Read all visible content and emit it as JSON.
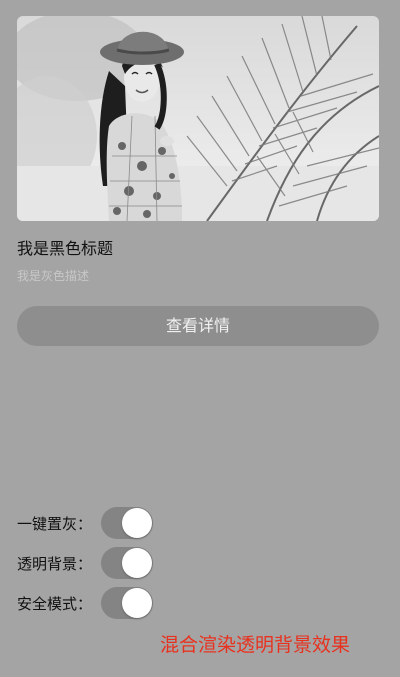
{
  "card": {
    "image_description": "",
    "title": "我是黑色标题",
    "description": "我是灰色描述",
    "detail_button_label": "查看详情"
  },
  "toggles": [
    {
      "label": "一键置灰：",
      "on": true
    },
    {
      "label": "透明背景：",
      "on": true
    },
    {
      "label": "安全模式：",
      "on": true
    }
  ],
  "caption": "混合渲染透明背景效果",
  "colors": {
    "background": "#a4a4a4",
    "button": "#8e8e8e",
    "switch_track": "#848484",
    "caption": "#e8321f"
  }
}
